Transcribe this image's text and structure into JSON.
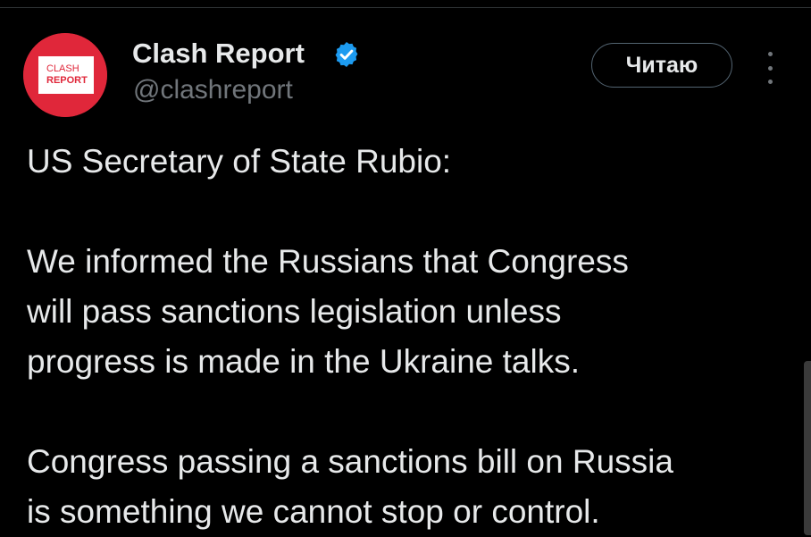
{
  "tweet": {
    "author": {
      "name": "Clash Report",
      "handle": "@clashreport",
      "verified": true,
      "avatar": {
        "logo_line1": "CLASH",
        "logo_line2": "REPORT",
        "background_color": "#e0273a"
      }
    },
    "follow_button_label": "Читаю",
    "more_icon": "more-vertical-icon",
    "verified_icon": "verified-badge-icon",
    "verified_color": "#1d9bf0",
    "paragraphs": [
      "US Secretary of State Rubio:",
      "We informed the Russians that Congress\nwill pass sanctions legislation unless\nprogress is made in the Ukraine talks.",
      "Congress passing a sanctions bill on Russia\nis something we cannot stop or control."
    ]
  },
  "theme": {
    "background": "#000000",
    "text_primary": "#e7e9ea",
    "text_secondary": "#71767b"
  }
}
